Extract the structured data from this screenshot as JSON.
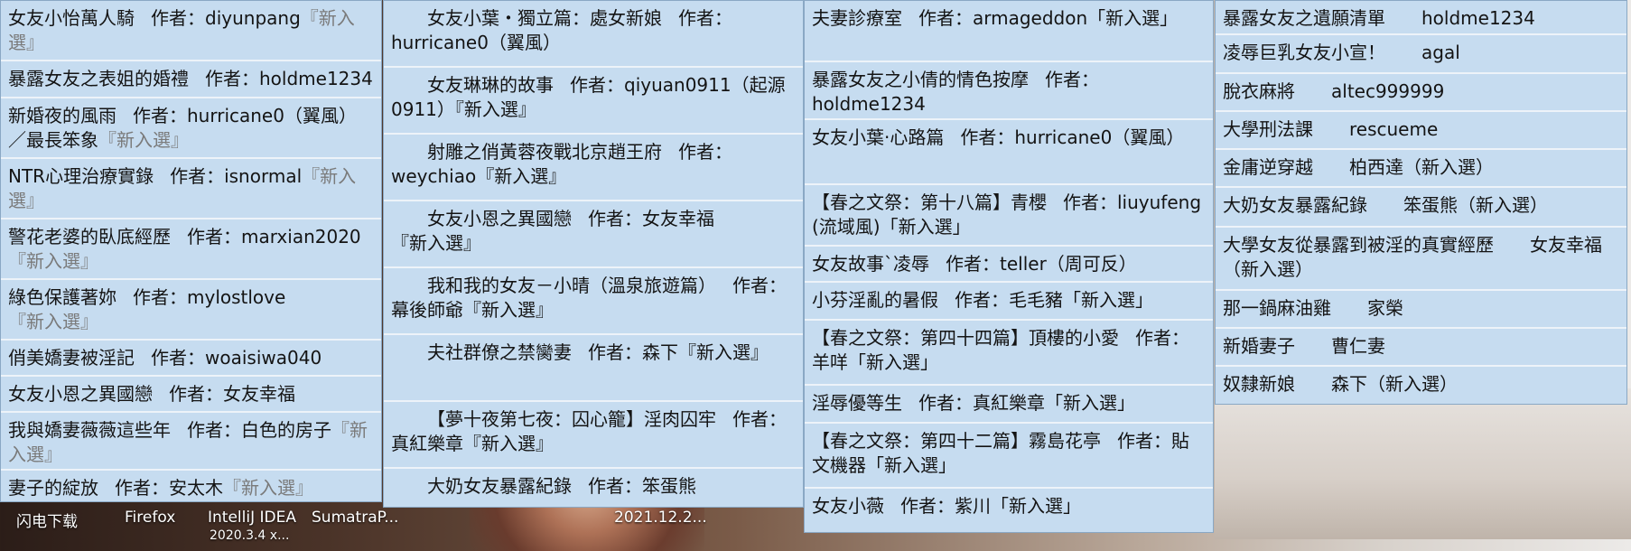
{
  "panel1": [
    {
      "title": "女友小怡萬人騎",
      "author_label": "作者：",
      "author": "diyunpang",
      "tag": "『新入選』"
    },
    {
      "title": "暴露女友之表姐的婚禮",
      "author_label": "作者：",
      "author": "holdme1234",
      "tag": ""
    },
    {
      "title": "新婚夜的風雨",
      "author_label": "作者：",
      "author": "hurricane0（翼風）／最長笨象",
      "tag": "『新入選』"
    },
    {
      "title": "NTR心理治療實錄",
      "author_label": "作者：",
      "author": "isnormal",
      "tag": "『新入選』"
    },
    {
      "title": "警花老婆的臥底經歷",
      "author_label": "作者：",
      "author": "marxian2020",
      "tag": "『新入選』"
    },
    {
      "title": "綠色保護著妳",
      "author_label": "作者：",
      "author": "mylostlove",
      "tag": "『新入選』"
    },
    {
      "title": "俏美嬌妻被淫記",
      "author_label": "作者：",
      "author": "woaisiwa040",
      "tag": ""
    },
    {
      "title": "女友小恩之異國戀",
      "author_label": "作者：",
      "author": "女友幸福",
      "tag": ""
    },
    {
      "title": "我與嬌妻薇薇這些年",
      "author_label": "作者：",
      "author": "白色的房子",
      "tag": "『新入選』"
    },
    {
      "title": "妻子的綻放",
      "author_label": "作者：",
      "author": "安太木",
      "tag": "『新入選』"
    }
  ],
  "panel2": [
    {
      "title": "女友小葉・獨立篇：處女新娘",
      "author_label": "作者：",
      "author": "hurricane0（翼風）",
      "tag": ""
    },
    {
      "title": "女友琳琳的故事",
      "author_label": "作者：",
      "author": "qiyuan0911（起源0911）",
      "tag": "『新入選』"
    },
    {
      "title": "射雕之俏黃蓉夜戰北京趙王府",
      "author_label": "作者：",
      "author": "weychiao",
      "tag": "『新入選』"
    },
    {
      "title": "女友小恩之異國戀",
      "author_label": "作者：",
      "author": "女友幸福",
      "tag": "『新入選』"
    },
    {
      "title": "我和我的女友－小晴（溫泉旅遊篇）",
      "author_label": "作者：",
      "author": "幕後師爺",
      "tag": "『新入選』"
    },
    {
      "title": "夫社群僚之禁臠妻",
      "author_label": "作者：",
      "author": "森下",
      "tag": "『新入選』"
    },
    {
      "title": "【夢十夜第七夜：囚心籠】淫肉囚牢",
      "author_label": "作者：",
      "author": "真紅樂章",
      "tag": "『新入選』"
    },
    {
      "title": "大奶女友暴露紀錄",
      "author_label": "作者：",
      "author": "笨蛋熊",
      "tag": ""
    }
  ],
  "panel3": [
    {
      "title": "夫妻診療室",
      "author_label": "作者：",
      "author": "armageddon",
      "tag": "「新入選」"
    },
    {
      "title": "暴露女友之小倩的情色按摩",
      "author_label": "作者：",
      "author": "holdme1234",
      "tag": ""
    },
    {
      "title": "女友小葉·心路篇",
      "author_label": "作者：",
      "author": "hurricane0（翼風）",
      "tag": ""
    },
    {
      "title": "【春之文祭：第十八篇】青櫻",
      "author_label": "作者：",
      "author": "liuyufeng (流域風)",
      "tag": "「新入選」"
    },
    {
      "title": "女友故事`凌辱",
      "author_label": "作者：",
      "author": "teller（周可反）",
      "tag": ""
    },
    {
      "title": "小芬淫亂的暑假",
      "author_label": "作者：",
      "author": "毛毛豬",
      "tag": "「新入選」"
    },
    {
      "title": "【春之文祭：第四十四篇】頂樓的小愛",
      "author_label": "作者：",
      "author": "羊咩",
      "tag": "「新入選」"
    },
    {
      "title": "淫辱優等生",
      "author_label": "作者：",
      "author": "真紅樂章",
      "tag": "「新入選」"
    },
    {
      "title": "【春之文祭：第四十二篇】霧島花亭",
      "author_label": "作者：",
      "author": "貼文機器",
      "tag": "「新入選」"
    },
    {
      "title": "女友小薇",
      "author_label": "作者：",
      "author": "紫川",
      "tag": "「新入選」"
    }
  ],
  "panel4": [
    {
      "title": "暴露女友之遺願清單",
      "author": "holdme1234"
    },
    {
      "title": "凌辱巨乳女友小宣！",
      "author": "agal"
    },
    {
      "title": "脫衣麻將",
      "author": "altec999999"
    },
    {
      "title": "大學刑法課",
      "author": "rescueme"
    },
    {
      "title": "金庸逆穿越",
      "author": "柏西達（新入選）"
    },
    {
      "title": "大奶女友暴露紀錄",
      "author": "笨蛋熊（新入選）"
    },
    {
      "title": "大學女友從暴露到被淫的真實經歷",
      "author": "女友幸福（新入選）"
    },
    {
      "title": "那一鍋麻油雞",
      "author": "家榮"
    },
    {
      "title": "新婚妻子",
      "author": "曹仁妻"
    },
    {
      "title": "奴隸新娘",
      "author": "森下（新入選）"
    }
  ],
  "desktop": {
    "icon1": "闪电下载",
    "icon2": "Firefox",
    "icon3": "IntelliJ IDEA",
    "icon3_sub": "2020.3.4 x...",
    "icon4": "SumatraP...",
    "icon5": "2021.12.2..."
  }
}
